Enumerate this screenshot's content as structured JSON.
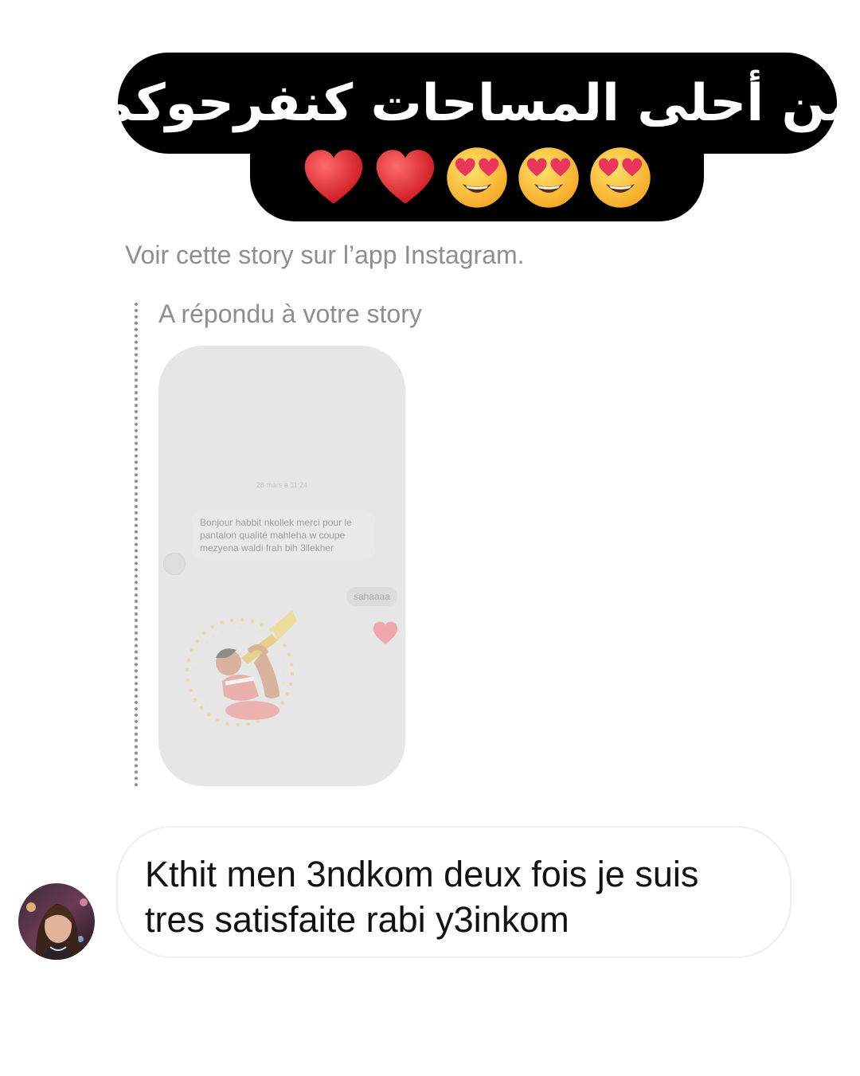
{
  "caption": {
    "text": "من أحلى المساحات كنفرحوكم",
    "emojis": [
      "red-heart",
      "red-heart",
      "heart-eyes-face",
      "heart-eyes-face",
      "heart-eyes-face"
    ]
  },
  "story_link": "Voir cette story sur l’app Instagram.",
  "reply": {
    "label": "A répondu à votre story",
    "story": {
      "date": "28 mars à 11:24",
      "message": "Bonjour habbit nkollek merci pour le pantalon qualité mahleha w coupe mezyena waldi frah bih 3llekher",
      "reply": "sahaaaa"
    }
  },
  "message": {
    "text": "Kthit men 3ndkom deux fois je suis tres satisfaite rabi y3inkom"
  },
  "colors": {
    "caption_bg": "#000000",
    "caption_text": "#ffffff",
    "muted_text": "#8e8e8e",
    "story_bg": "#e6e6e6",
    "bubble_border": "#efefef"
  }
}
